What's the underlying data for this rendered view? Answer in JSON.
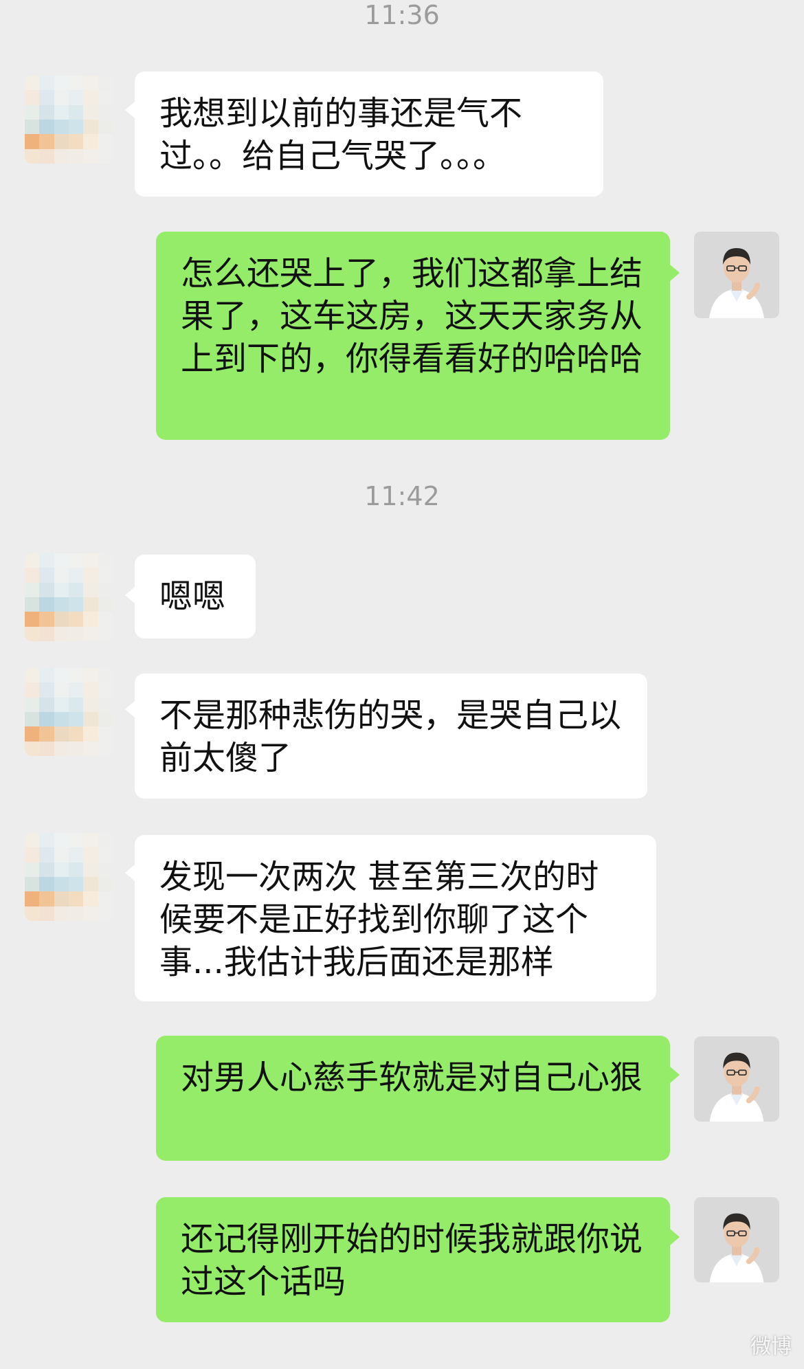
{
  "chat": {
    "timestamps": [
      "11:36",
      "11:42"
    ],
    "messages": [
      {
        "sender": "other",
        "text": "我想到以前的事还是气不过。。给自己气哭了。。。"
      },
      {
        "sender": "self",
        "text": "怎么还哭上了，我们这都拿上结果了，这车这房，这天天家务从上到下的，你得看看好的哈哈哈"
      },
      {
        "sender": "other",
        "text": "嗯嗯"
      },
      {
        "sender": "other",
        "text": "不是那种悲伤的哭，是哭自己以前太傻了"
      },
      {
        "sender": "other",
        "text": "发现一次两次 甚至第三次的时候要不是正好找到你聊了这个事...我估计我后面还是那样"
      },
      {
        "sender": "self",
        "text": "对男人心慈手软就是对自己心狠"
      },
      {
        "sender": "self",
        "text": "还记得刚开始的时候我就跟你说过这个话吗"
      }
    ]
  },
  "colors": {
    "background": "#ededed",
    "incoming_bubble": "#ffffff",
    "outgoing_bubble": "#95ec69",
    "timestamp": "#9b9b9b"
  },
  "watermark": {
    "text": "微博"
  }
}
